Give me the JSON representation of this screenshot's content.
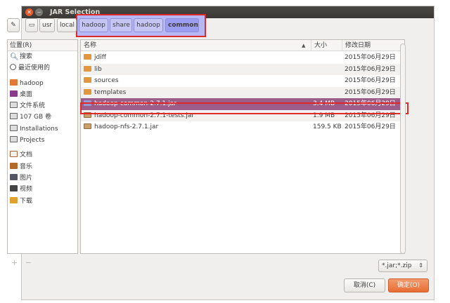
{
  "window": {
    "title": "JAR Selection"
  },
  "pathbar": {
    "edit_icon": "pencil-icon",
    "drive_icon": "drive-icon",
    "crumbs": [
      "usr",
      "local",
      "hadoop",
      "share",
      "hadoop",
      "common"
    ]
  },
  "sidebar": {
    "header": "位置(R)",
    "items": [
      {
        "label": "搜索",
        "icon": "search-icon"
      },
      {
        "label": "最近使用的",
        "icon": "recent-icon"
      },
      {
        "label": "hadoop",
        "icon": "home-folder-icon"
      },
      {
        "label": "桌面",
        "icon": "desktop-icon"
      },
      {
        "label": "文件系统",
        "icon": "drive-icon"
      },
      {
        "label": "107 GB 卷",
        "icon": "drive-icon"
      },
      {
        "label": "Installations",
        "icon": "drive-icon"
      },
      {
        "label": "Projects",
        "icon": "drive-icon"
      },
      {
        "label": "文档",
        "icon": "documents-icon"
      },
      {
        "label": "音乐",
        "icon": "music-icon"
      },
      {
        "label": "图片",
        "icon": "pictures-icon"
      },
      {
        "label": "视频",
        "icon": "videos-icon"
      },
      {
        "label": "下载",
        "icon": "downloads-icon"
      }
    ],
    "add_symbol": "+",
    "remove_symbol": "−"
  },
  "files": {
    "columns": {
      "name": "名称",
      "size": "大小",
      "modified": "修改日期"
    },
    "rows": [
      {
        "name": "jdiff",
        "size": "",
        "modified": "2015年06月29日",
        "type": "folder"
      },
      {
        "name": "lib",
        "size": "",
        "modified": "2015年06月29日",
        "type": "folder"
      },
      {
        "name": "sources",
        "size": "",
        "modified": "2015年06月29日",
        "type": "folder"
      },
      {
        "name": "templates",
        "size": "",
        "modified": "2015年06月29日",
        "type": "folder"
      },
      {
        "name": "hadoop-common-2.7.1.jar",
        "size": "3.4 MB",
        "modified": "2015年06月29日",
        "type": "jar",
        "selected": true
      },
      {
        "name": "hadoop-common-2.7.1-tests.jar",
        "size": "1.9 MB",
        "modified": "2015年06月29日",
        "type": "jar"
      },
      {
        "name": "hadoop-nfs-2.7.1.jar",
        "size": "159.5 KB",
        "modified": "2015年06月29日",
        "type": "jar"
      }
    ]
  },
  "filter": {
    "value": "*.jar;*.zip"
  },
  "buttons": {
    "cancel": "取消(C)",
    "ok": "确定(O)"
  },
  "colors": {
    "accent": "#e86c33",
    "selection": "#9b5e8a",
    "annotation": "#e02a2a"
  }
}
